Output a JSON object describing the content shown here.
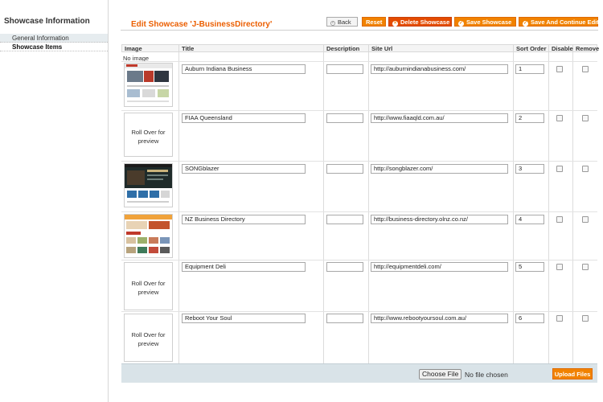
{
  "sidebar": {
    "title": "Showcase Information",
    "tabs": [
      {
        "label": "General Information",
        "active": false
      },
      {
        "label": "Showcase Items",
        "active": true
      }
    ]
  },
  "header": {
    "title": "Edit Showcase 'J-BusinessDirectory'",
    "buttons": {
      "back": "Back",
      "reset": "Reset",
      "delete": "Delete Showcase",
      "save": "Save Showcase",
      "save_continue": "Save And Continue Edit"
    }
  },
  "grid": {
    "columns": [
      "Image",
      "Title",
      "Description",
      "Site Url",
      "Sort Order",
      "Disable",
      "Remove"
    ],
    "no_image_text": "No image",
    "rollover_text": "Roll Over for preview",
    "rows": [
      {
        "image": "thumbnail",
        "title": "Auburn Indiana Business",
        "description": "",
        "url": "http://auburnindianabusiness.com/",
        "sort": "1",
        "disable": false,
        "remove": false
      },
      {
        "image": "rollover",
        "title": "FIAA Queensland",
        "description": "",
        "url": "http://www.fiaaqld.com.au/",
        "sort": "2",
        "disable": false,
        "remove": false
      },
      {
        "image": "thumbnail",
        "title": "SONGblazer",
        "description": "",
        "url": "http://songblazer.com/",
        "sort": "3",
        "disable": false,
        "remove": false
      },
      {
        "image": "thumbnail",
        "title": "NZ Business Directory",
        "description": "",
        "url": "http://business-directory.olnz.co.nz/",
        "sort": "4",
        "disable": false,
        "remove": false
      },
      {
        "image": "rollover",
        "title": "Equipment Deli",
        "description": "",
        "url": "http://equipmentdeli.com/",
        "sort": "5",
        "disable": false,
        "remove": false
      },
      {
        "image": "rollover",
        "title": "Reboot Your Soul",
        "description": "",
        "url": "http://www.rebootyoursoul.com.au/",
        "sort": "6",
        "disable": false,
        "remove": false
      }
    ]
  },
  "footer": {
    "choose_file": "Choose File",
    "no_file": "No file chosen",
    "upload": "Upload Files"
  },
  "colors": {
    "accent": "#eb5e00",
    "button": "#f18200",
    "footer_bg": "#d9e3e8"
  }
}
